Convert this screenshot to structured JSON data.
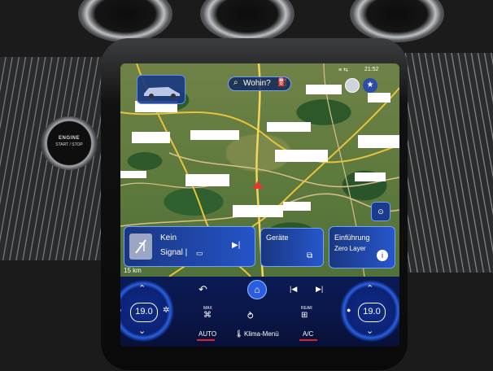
{
  "status_bar": {
    "time": "21:52"
  },
  "nav": {
    "search_label": "Wohin?"
  },
  "tiles": {
    "media_title": "Kein",
    "media_subtitle": "Signal |",
    "devices_title": "Geräte",
    "intro_title": "Einführung",
    "intro_subtitle": "Zero Layer"
  },
  "map": {
    "scale": "15 km"
  },
  "climate": {
    "left_temp": "19.0",
    "right_temp": "19.0",
    "auto_label": "AUTO",
    "menu_label": "Klima-Menü",
    "ac_label": "A/C",
    "max_label": "MAX",
    "rear_label": "REAR"
  },
  "engine_button": {
    "line1": "ENGINE",
    "line2": "START / STOP"
  },
  "colors": {
    "accent_blue": "#2f6bff",
    "underline_red": "#e0202a"
  }
}
